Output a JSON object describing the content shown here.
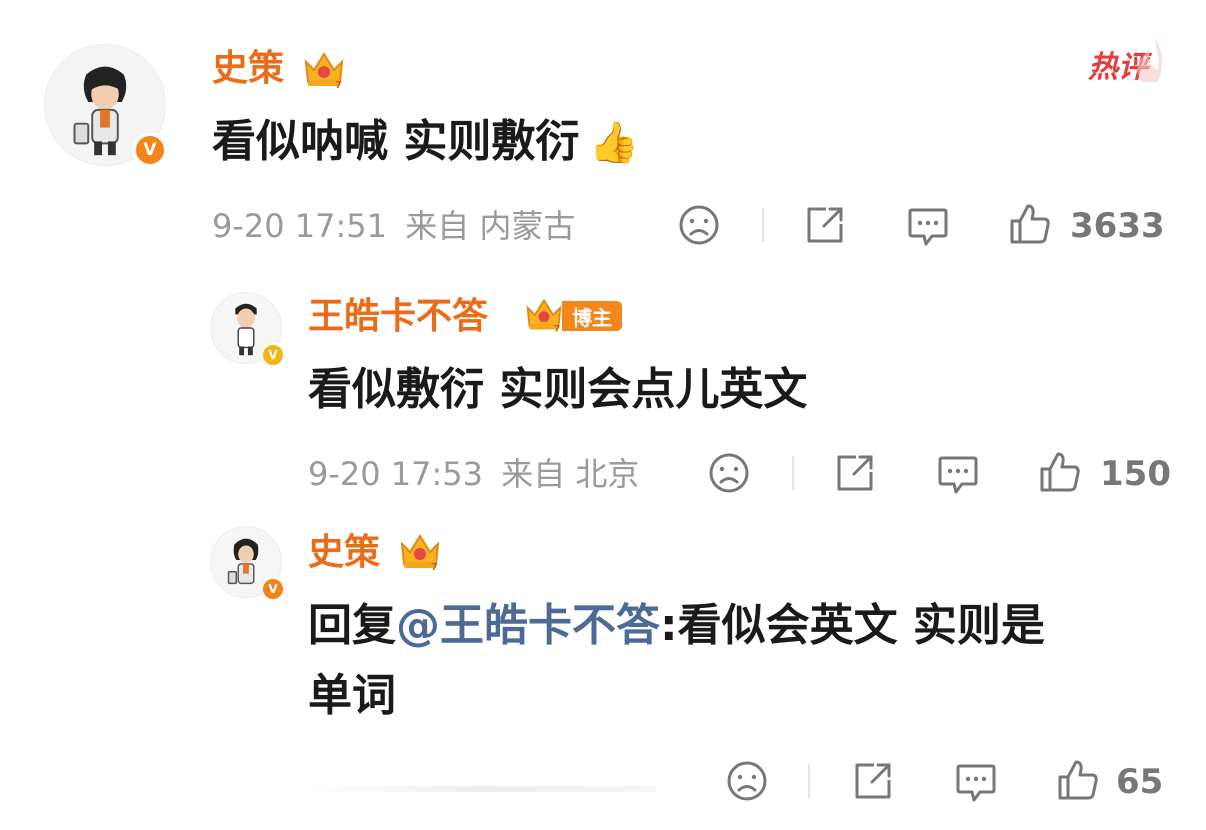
{
  "comment": {
    "username": "史策",
    "hot_label": "热评",
    "text": "看似呐喊 实则敷衍",
    "emoji": "👍",
    "timestamp": "9-20 17:51",
    "location": "来自 内蒙古",
    "likes": "3633"
  },
  "reply1": {
    "username": "王皓卡不答",
    "tag": "博主",
    "text": "看似敷衍 实则会点儿英文",
    "timestamp": "9-20 17:53",
    "location": "来自 北京",
    "likes": "150"
  },
  "reply2": {
    "username": "史策",
    "reply_prefix": "回复",
    "mention": "@王皓卡不答",
    "text_line1": ":看似会英文 实则是",
    "text_line2": "单词",
    "likes": "65"
  },
  "colors": {
    "username": "#ec6b16",
    "meta": "#9a9a9a",
    "mention": "#4d6a94",
    "hot": "#e63c3c"
  },
  "icons": [
    "crown-icon",
    "verified-icon",
    "dislike-icon",
    "share-icon",
    "comment-icon",
    "like-icon",
    "hot-flame-icon"
  ]
}
